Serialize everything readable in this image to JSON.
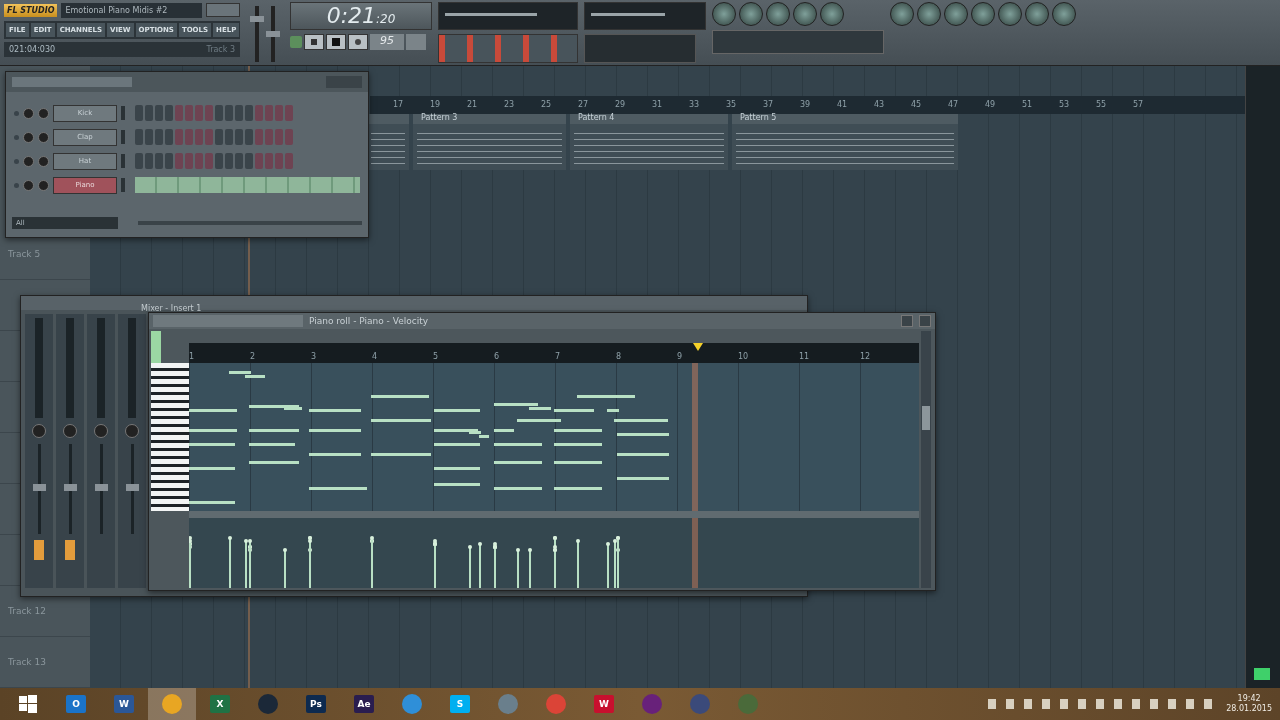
{
  "app": {
    "logo": "FL STUDIO",
    "song_title": "Emotional Piano Midis #2",
    "menu": [
      "FILE",
      "EDIT",
      "CHANNELS",
      "VIEW",
      "OPTIONS",
      "TOOLS",
      "HELP"
    ],
    "position": "021:04:030",
    "hint": "Track 3"
  },
  "master": {
    "volume": {
      "level": 0.8
    },
    "pitch": {
      "level": 0.5
    }
  },
  "transport": {
    "time_main": "0:21",
    "time_sub": ":20",
    "tempo": "95"
  },
  "playlist": {
    "ruler": [
      "17",
      "19",
      "21",
      "23",
      "25",
      "27",
      "29",
      "31",
      "33",
      "35",
      "37",
      "39",
      "41",
      "43",
      "45",
      "47",
      "49",
      "51",
      "53",
      "55",
      "57"
    ],
    "patterns": [
      {
        "name": "Pattern 3"
      },
      {
        "name": "Pattern 4"
      },
      {
        "name": "Pattern 5"
      }
    ],
    "tracks": [
      {
        "name": "Track 5"
      },
      {
        "name": "Track 12"
      },
      {
        "name": "Track 13"
      }
    ]
  },
  "channel_rack": {
    "filter": "All",
    "channels": [
      {
        "name": "Kick",
        "selected": false
      },
      {
        "name": "Clap",
        "selected": false
      },
      {
        "name": "Hat",
        "selected": false
      },
      {
        "name": "Piano",
        "selected": true
      }
    ]
  },
  "mixer": {
    "title": "Mixer - Insert 1"
  },
  "piano_roll": {
    "title": "Piano roll - Piano - Velocity",
    "ruler": [
      "1",
      "2",
      "3",
      "4",
      "5",
      "6",
      "7",
      "8",
      "9",
      "10",
      "11",
      "12"
    ]
  },
  "taskbar": {
    "apps": [
      {
        "kind": "start"
      },
      {
        "kind": "letter",
        "label": "O",
        "color": "#1a73c8",
        "selected": false
      },
      {
        "kind": "letter",
        "label": "W",
        "color": "#2b5797",
        "selected": false
      },
      {
        "kind": "round",
        "color": "#e8a623",
        "selected": true
      },
      {
        "kind": "letter",
        "label": "X",
        "color": "#1f7244",
        "selected": false
      },
      {
        "kind": "round",
        "color": "#1b2838",
        "selected": false
      },
      {
        "kind": "letter",
        "label": "Ps",
        "color": "#0d2a4f",
        "selected": false
      },
      {
        "kind": "letter",
        "label": "Ae",
        "color": "#2a1d4f",
        "selected": false
      },
      {
        "kind": "round",
        "color": "#2f8fd8",
        "selected": false
      },
      {
        "kind": "letter",
        "label": "S",
        "color": "#00aff0",
        "selected": false
      },
      {
        "kind": "round",
        "color": "#6a7f8c",
        "selected": false
      },
      {
        "kind": "round",
        "color": "#db4437",
        "selected": false
      },
      {
        "kind": "letter",
        "label": "W",
        "color": "#c8102e",
        "selected": false
      },
      {
        "kind": "round",
        "color": "#68217a",
        "selected": false
      },
      {
        "kind": "round",
        "color": "#3b4a7a",
        "selected": false
      },
      {
        "kind": "round",
        "color": "#4a6a3a",
        "selected": false
      }
    ],
    "time": "19:42",
    "date": "28.01.2015"
  }
}
